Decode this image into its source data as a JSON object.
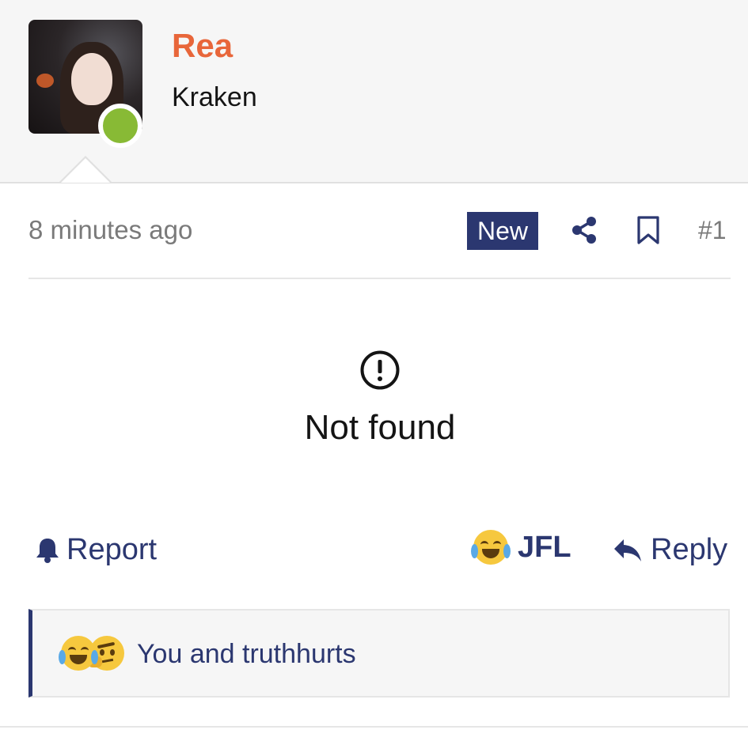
{
  "user": {
    "name": "Rea",
    "title": "Kraken",
    "online": true
  },
  "post": {
    "timestamp": "8 minutes ago",
    "badge": "New",
    "number": "#1",
    "content_error": "Not found"
  },
  "actions": {
    "report": "Report",
    "jfl": "JFL",
    "reply": "Reply"
  },
  "reactions": {
    "text": "You and truthhurts",
    "icons": [
      "laughing-crying-emoji",
      "thinking-emoji"
    ]
  },
  "colors": {
    "username": "#e8663a",
    "accent": "#2b3770",
    "online": "#88ba35"
  }
}
